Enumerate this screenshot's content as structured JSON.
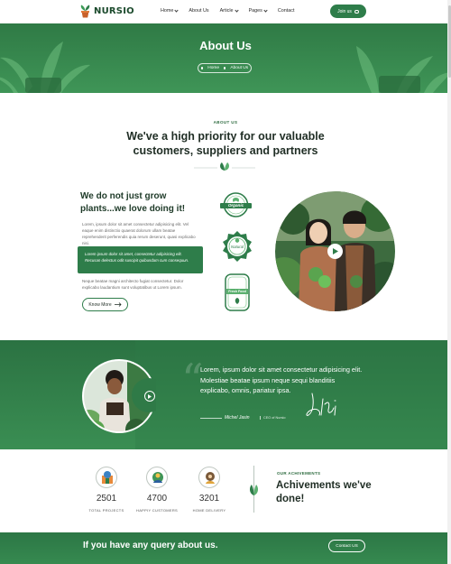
{
  "brand": {
    "name": "NURSIO",
    "accent": "#2e7d4a",
    "dark": "#1f2d24"
  },
  "nav": {
    "items": [
      {
        "label": "Home",
        "has_caret": true
      },
      {
        "label": "About Us",
        "has_caret": false
      },
      {
        "label": "Article",
        "has_caret": true
      },
      {
        "label": "Pages",
        "has_caret": true
      },
      {
        "label": "Contact",
        "has_caret": false
      }
    ],
    "join_label": "Join us"
  },
  "hero": {
    "title": "About Us",
    "breadcrumb": [
      "Home",
      "About Us"
    ]
  },
  "about": {
    "tag": "ABOUT US",
    "heading": "We've a high priority for our valuable customers, suppliers and partners",
    "subheading": "We do not just grow plants...we love doing it!",
    "para1": "Lorem, ipsum dolor sit amet consectetur adipisicing elit. Vel eaque enim distinctio quaerat dolorum ullam beatae reprehenderit perferendis quia rerum deserunt, quasi explicabo nisi.",
    "highlight": "Lorem ipsum dolor sit amet, consectetur adipisicing elit. Recusan delectus odit suscipit quibusdam cum consequun.",
    "para2": "Neque beatae magni architecto fugiat consectetur. Dolor explicabo laudantium sunt voluptatibus ut Lorem ipsum.",
    "button_label": "Know More",
    "badges": [
      {
        "name": "organic",
        "text": "Organic"
      },
      {
        "name": "natural",
        "text": "Natural"
      },
      {
        "name": "fresh-food",
        "text": "Fresh Food"
      }
    ]
  },
  "testimonial": {
    "quote": "Lorem, ipsum dolor sit amet consectetur adipisicing elit. Molestiae beatae ipsum neque sequi blanditiis explicabo, omnis, pariatur ipsa.",
    "name": "Michel Jasin",
    "role": "CEO of Nursio"
  },
  "stats": [
    {
      "icon": "project-icon",
      "value": "2501",
      "label": "TOTAL PROJECTS"
    },
    {
      "icon": "customer-icon",
      "value": "4700",
      "label": "HAPPIY CUSTOMERS"
    },
    {
      "icon": "delivery-icon",
      "value": "3201",
      "label": "HOME DELIVERY"
    }
  ],
  "achievements": {
    "tag": "OUR ACHIVEMENTS",
    "title": "Achivements we've done!"
  },
  "cta": {
    "text": "If you have any query about us.",
    "button_label": "Contact US"
  }
}
